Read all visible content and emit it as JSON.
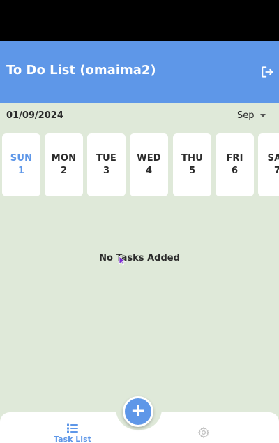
{
  "header": {
    "title": "To Do List (omaima2)",
    "logout_icon": "logout-icon"
  },
  "date_bar": {
    "date": "01/09/2024",
    "month": "Sep"
  },
  "days": [
    {
      "name": "SUN",
      "num": "1",
      "selected": true
    },
    {
      "name": "MON",
      "num": "2"
    },
    {
      "name": "TUE",
      "num": "3"
    },
    {
      "name": "WED",
      "num": "4"
    },
    {
      "name": "THU",
      "num": "5"
    },
    {
      "name": "FRI",
      "num": "6"
    },
    {
      "name": "SAT",
      "num": "7"
    }
  ],
  "empty_state": "No Tasks Added",
  "bottom_nav": {
    "task_list_label": "Task List",
    "task_list_icon": "list-icon",
    "settings_icon": "gear-icon",
    "add_icon": "plus-icon"
  },
  "colors": {
    "accent": "#5e97e8",
    "background": "#dfe9d9",
    "status_bar": "#000000"
  }
}
